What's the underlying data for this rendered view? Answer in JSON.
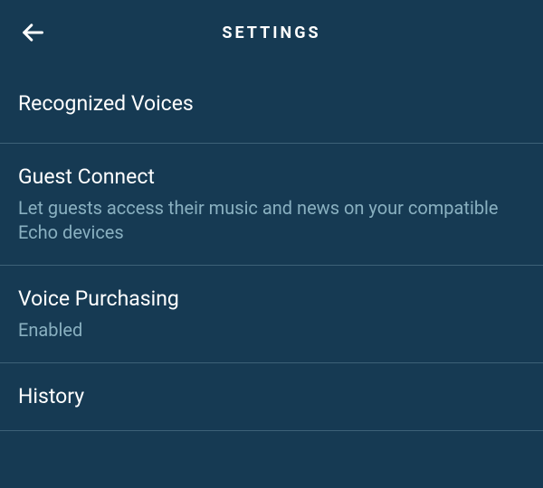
{
  "header": {
    "title": "SETTINGS"
  },
  "items": [
    {
      "title": "Recognized Voices",
      "subtitle": null
    },
    {
      "title": "Guest Connect",
      "subtitle": "Let guests access their music and news on your compatible Echo devices"
    },
    {
      "title": "Voice Purchasing",
      "subtitle": "Enabled"
    },
    {
      "title": "History",
      "subtitle": null
    }
  ]
}
